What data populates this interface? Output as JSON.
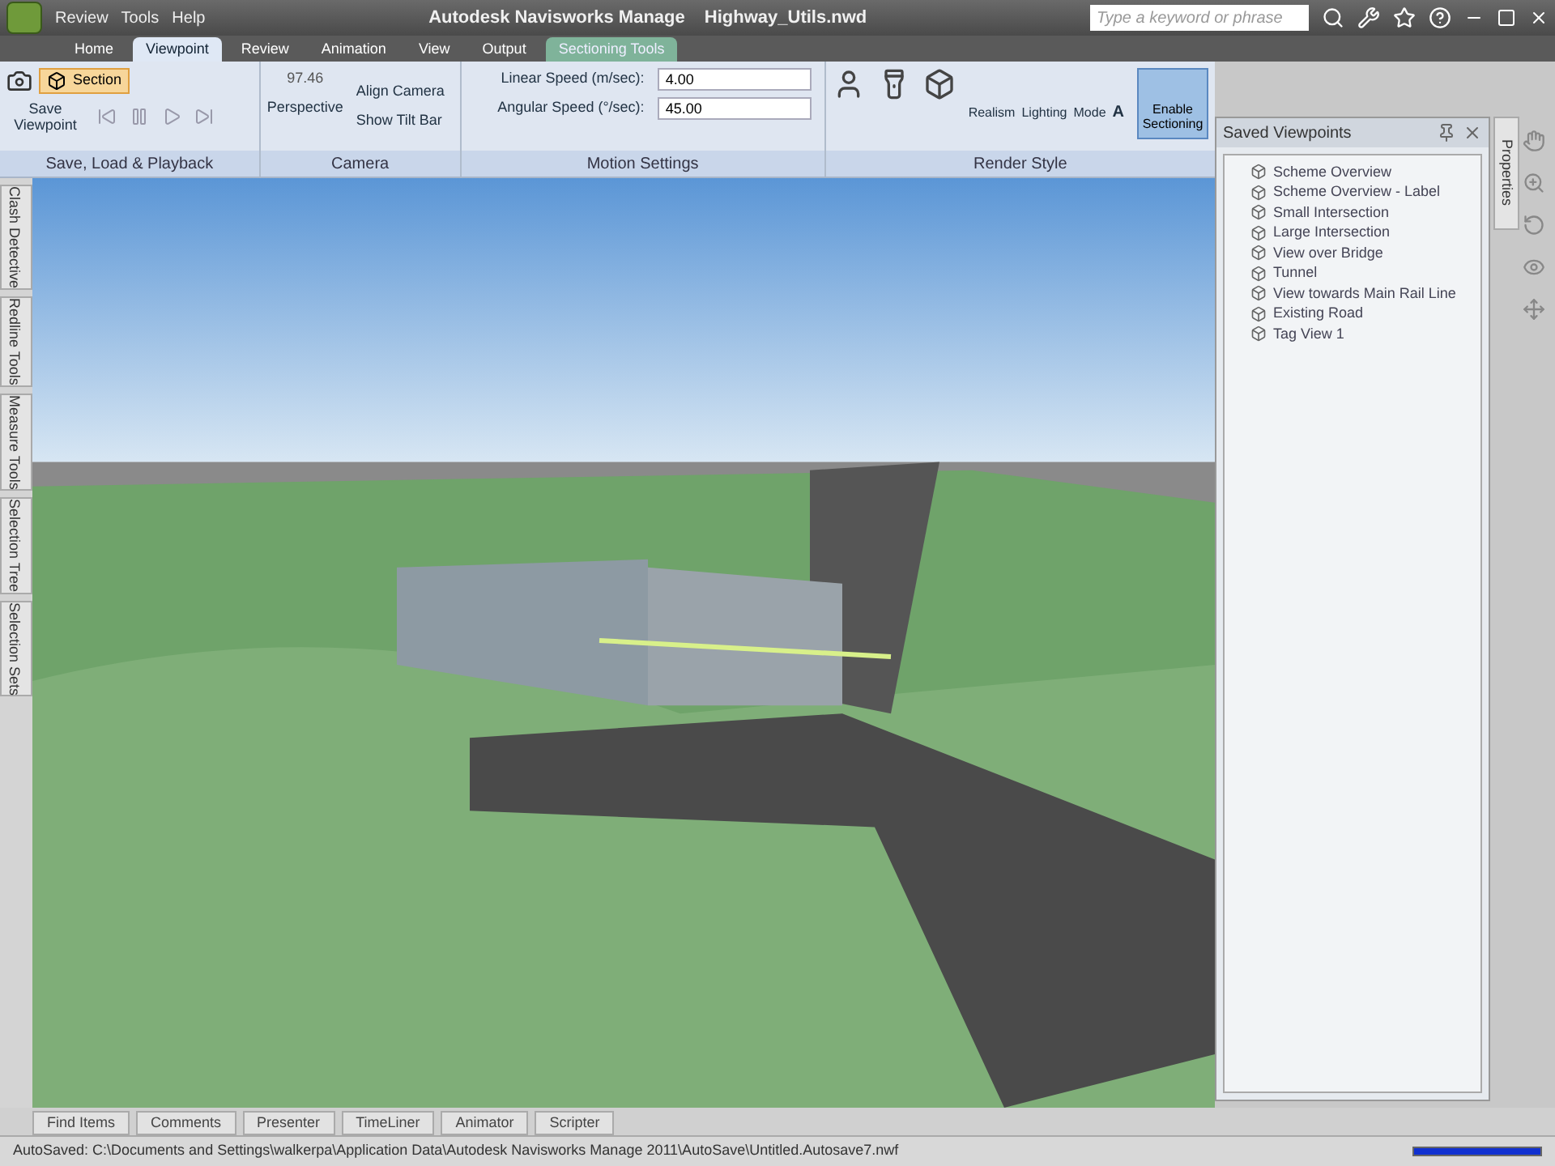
{
  "title_bar": {
    "menus": [
      "Review",
      "Tools",
      "Help"
    ],
    "app": "Autodesk Navisworks Manage",
    "file": "Highway_Utils.nwd",
    "search": {
      "placeholder": "Type a keyword or phrase"
    }
  },
  "ribbon_tabs": [
    {
      "label": "Home",
      "selected": false,
      "kind": "normal"
    },
    {
      "label": "Viewpoint",
      "selected": true,
      "kind": "normal"
    },
    {
      "label": "Review",
      "selected": false,
      "kind": "normal"
    },
    {
      "label": "Animation",
      "selected": false,
      "kind": "normal"
    },
    {
      "label": "View",
      "selected": false,
      "kind": "normal"
    },
    {
      "label": "Output",
      "selected": false,
      "kind": "normal"
    },
    {
      "label": "Sectioning Tools",
      "selected": false,
      "kind": "contextual"
    }
  ],
  "ribbon": {
    "save_panel": {
      "title": "Save, Load & Playback",
      "save_button": "Save Viewpoint",
      "section_button": "Section"
    },
    "camera_panel": {
      "title": "Camera",
      "projection": "Perspective",
      "align": "Align Camera",
      "tilt": "Show Tilt Bar",
      "field_value": "97.46"
    },
    "motion_panel": {
      "title": "Motion Settings",
      "fields": [
        {
          "label": "Linear Speed (m/sec):",
          "value": "4.00"
        },
        {
          "label": "Angular Speed (°/sec):",
          "value": "45.00"
        }
      ]
    },
    "render_panel": {
      "title": "Render Style",
      "buttons": [
        "Realism",
        "Lighting",
        "Mode"
      ],
      "text_button": "A"
    },
    "enable_sectioning": {
      "label": "Enable Sectioning",
      "on": true
    }
  },
  "left_tabs": [
    "Clash Detective",
    "Redline Tools",
    "Measure Tools",
    "Selection Tree",
    "Selection Sets"
  ],
  "saved_viewpoints": {
    "title": "Saved Viewpoints",
    "items": [
      "Scheme Overview",
      "Scheme Overview - Label",
      "Small Intersection",
      "Large Intersection",
      "View over Bridge",
      "Tunnel",
      "View towards Main Rail Line",
      "Existing Road",
      "Tag View 1"
    ]
  },
  "right_tab": "Properties",
  "bottom_tabs": [
    "Find Items",
    "Comments",
    "Presenter",
    "TimeLiner",
    "Animator",
    "Scripter"
  ],
  "status_bar": {
    "text": "AutoSaved: C:\\Documents and Settings\\walkerpa\\Application Data\\Autodesk Navisworks Manage 2011\\AutoSave\\Untitled.Autosave7.nwf"
  }
}
